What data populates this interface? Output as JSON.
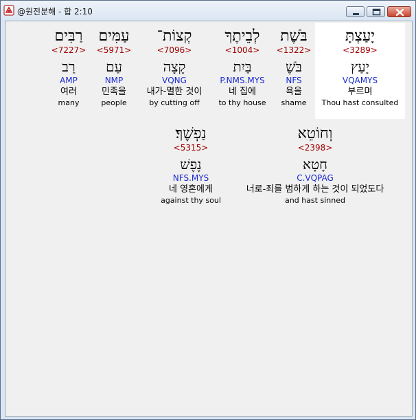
{
  "window": {
    "title": "@원전분해 - 합 2:10",
    "controls": {
      "minimize": "minimize",
      "maximize": "maximize",
      "close": "close"
    }
  },
  "rows": [
    {
      "words": [
        {
          "hebrew": "יָעַצְתָּ",
          "strong": "<3289>",
          "lemma": "יָעַץ",
          "morph": "VQAMYS",
          "korean": "부르며",
          "english": "Thou hast consulted",
          "highlight": true
        },
        {
          "hebrew": "בֹּשֶׁת",
          "strong": "<1322>",
          "lemma": "בֹּשֶׁ",
          "morph": "NFS",
          "korean": "욕을",
          "english": "shame",
          "highlight": false
        },
        {
          "hebrew": "לְבֵיתֶךָ",
          "strong": "<1004>",
          "lemma": "בַּיִת",
          "morph": "P.NMS.MYS",
          "korean": "네 집에",
          "english": "to thy house",
          "highlight": false
        },
        {
          "hebrew": "קְצוֹת־",
          "strong": "<7096>",
          "lemma": "קָצָה",
          "morph": "VQNG",
          "korean": "내가-멸한 것이",
          "english": "by cutting off",
          "highlight": false
        },
        {
          "hebrew": "עַמִּים",
          "strong": "<5971>",
          "lemma": "עַם",
          "morph": "NMP",
          "korean": "민족을",
          "english": "people",
          "highlight": false
        },
        {
          "hebrew": "רַבִּים",
          "strong": "<7227>",
          "lemma": "רַב",
          "morph": "AMP",
          "korean": "여러",
          "english": "many",
          "highlight": false
        }
      ]
    },
    {
      "words": [
        {
          "hebrew": "וְחוֹטֵא",
          "strong": "<2398>",
          "lemma": "חָטָא",
          "morph": "C.VQPAG",
          "korean": "너로-죄를 범하게 하는 것이 되었도다",
          "english": "and hast sinned",
          "highlight": false
        },
        {
          "hebrew": "נַפְשֶׁךָ׃",
          "strong": "<5315>",
          "lemma": "נֶפֶשׁ",
          "morph": "NFS.MYS",
          "korean": "네 영혼에게",
          "english": "against thy soul",
          "highlight": false
        }
      ]
    }
  ]
}
